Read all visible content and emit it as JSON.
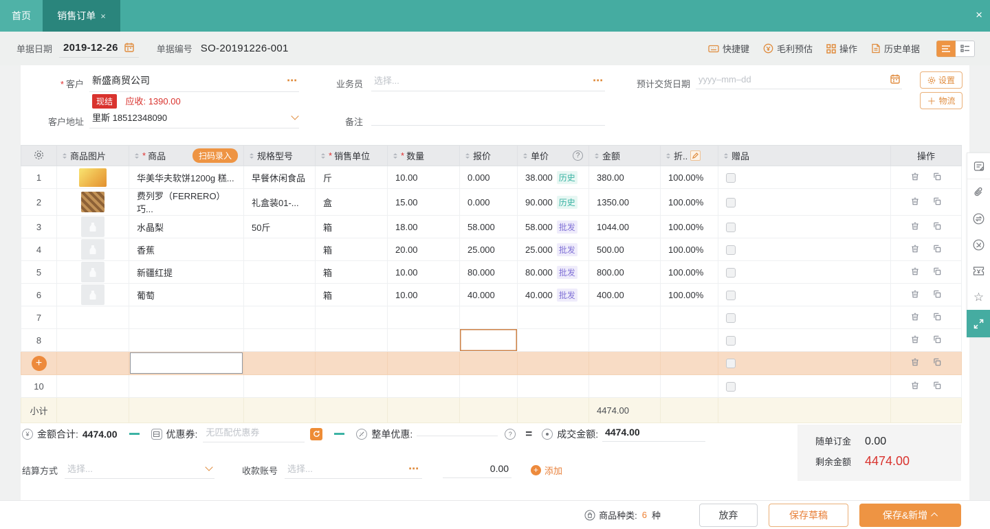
{
  "window": {
    "close_glyph": "×"
  },
  "tabs": {
    "home": "首页",
    "current": "销售订单",
    "close_glyph": "×"
  },
  "doc": {
    "date_label": "单据日期",
    "date_value": "2019-12-26",
    "no_label": "单据编号",
    "no_value": "SO-20191226-001",
    "tools": {
      "shortcut": {
        "icon": "keyboard-icon",
        "label": "快捷键"
      },
      "profit": {
        "icon": "coin-icon",
        "label": "毛利预估"
      },
      "actions": {
        "icon": "grid-icon",
        "label": "操作"
      },
      "history": {
        "icon": "document-icon",
        "label": "历史单据"
      }
    }
  },
  "form": {
    "customer_label": "客户",
    "customer_value": "新盛商贸公司",
    "settle_badge": "现结",
    "receivable_text": "应收: 1390.00",
    "address_label": "客户地址",
    "address_value": "里斯 18512348090",
    "salesman_label": "业务员",
    "salesman_placeholder": "选择...",
    "remark_label": "备注",
    "delivery_label": "预计交货日期",
    "delivery_placeholder": "yyyy–mm–dd",
    "settings_button": "设置",
    "logistics_button": "物流"
  },
  "table": {
    "headers": {
      "image": "商品图片",
      "product": "商品",
      "scan": "扫码录入",
      "spec": "规格型号",
      "unit": "销售单位",
      "qty": "数量",
      "quote": "报价",
      "price": "单价",
      "amount": "金额",
      "discount": "折..",
      "gift": "赠品",
      "action": "操作"
    },
    "rows": [
      {
        "no": "1",
        "name": "华美华夫软饼1200g 糕...",
        "spec": "早餐休闲食品",
        "unit": "斤",
        "qty": "10.00",
        "quote": "0.000",
        "price": "38.000",
        "tag": "历史",
        "amount": "380.00",
        "discount": "100.00%"
      },
      {
        "no": "2",
        "name": "费列罗（FERRERO）巧...",
        "spec": "礼盒装01-...",
        "unit": "盒",
        "qty": "15.00",
        "quote": "0.000",
        "price": "90.000",
        "tag": "历史",
        "amount": "1350.00",
        "discount": "100.00%"
      },
      {
        "no": "3",
        "name": "水晶梨",
        "spec": "50斤",
        "unit": "箱",
        "qty": "18.00",
        "quote": "58.000",
        "price": "58.000",
        "tag": "批发",
        "amount": "1044.00",
        "discount": "100.00%"
      },
      {
        "no": "4",
        "name": "香蕉",
        "spec": "",
        "unit": "箱",
        "qty": "20.00",
        "quote": "25.000",
        "price": "25.000",
        "tag": "批发",
        "amount": "500.00",
        "discount": "100.00%"
      },
      {
        "no": "5",
        "name": "新疆红提",
        "spec": "",
        "unit": "箱",
        "qty": "10.00",
        "quote": "80.000",
        "price": "80.000",
        "tag": "批发",
        "amount": "800.00",
        "discount": "100.00%"
      },
      {
        "no": "6",
        "name": "葡萄",
        "spec": "",
        "unit": "箱",
        "qty": "10.00",
        "quote": "40.000",
        "price": "40.000",
        "tag": "批发",
        "amount": "400.00",
        "discount": "100.00%"
      }
    ],
    "empty_rows": {
      "r7": "7",
      "r8": "8",
      "r10": "10"
    },
    "subtotal": {
      "label": "小计",
      "amount": "4474.00"
    }
  },
  "summary": {
    "total_label": "金额合计:",
    "total_value": "4474.00",
    "coupon_label": "优惠券:",
    "coupon_placeholder": "无匹配优惠券",
    "order_discount_label": "整单优惠:",
    "deal_label": "成交金额:",
    "deal_value": "4474.00"
  },
  "payment": {
    "method_label": "结算方式",
    "method_placeholder": "选择...",
    "account_label": "收款账号",
    "account_placeholder": "选择...",
    "amount_value": "0.00",
    "add_label": "添加"
  },
  "deposit": {
    "deposit_label": "随单订金",
    "deposit_value": "0.00",
    "remaining_label": "剩余金额",
    "remaining_value": "4474.00"
  },
  "footer": {
    "category_label": "商品种类:",
    "category_count": "6",
    "category_unit": "种",
    "abandon": "放弃",
    "save_draft": "保存草稿",
    "save_new": "保存&新增"
  },
  "colors": {
    "topbar_teal": "#45ACA1",
    "active_tab_teal": "#2A857C",
    "accent_orange": "#EE9443",
    "alert_red": "#D9332E",
    "tag_history": "#39B3A3",
    "tag_wholesale": "#8172D6",
    "add_row_peach": "#F8DCC5",
    "subtotal_cream": "#FAF6E8"
  }
}
